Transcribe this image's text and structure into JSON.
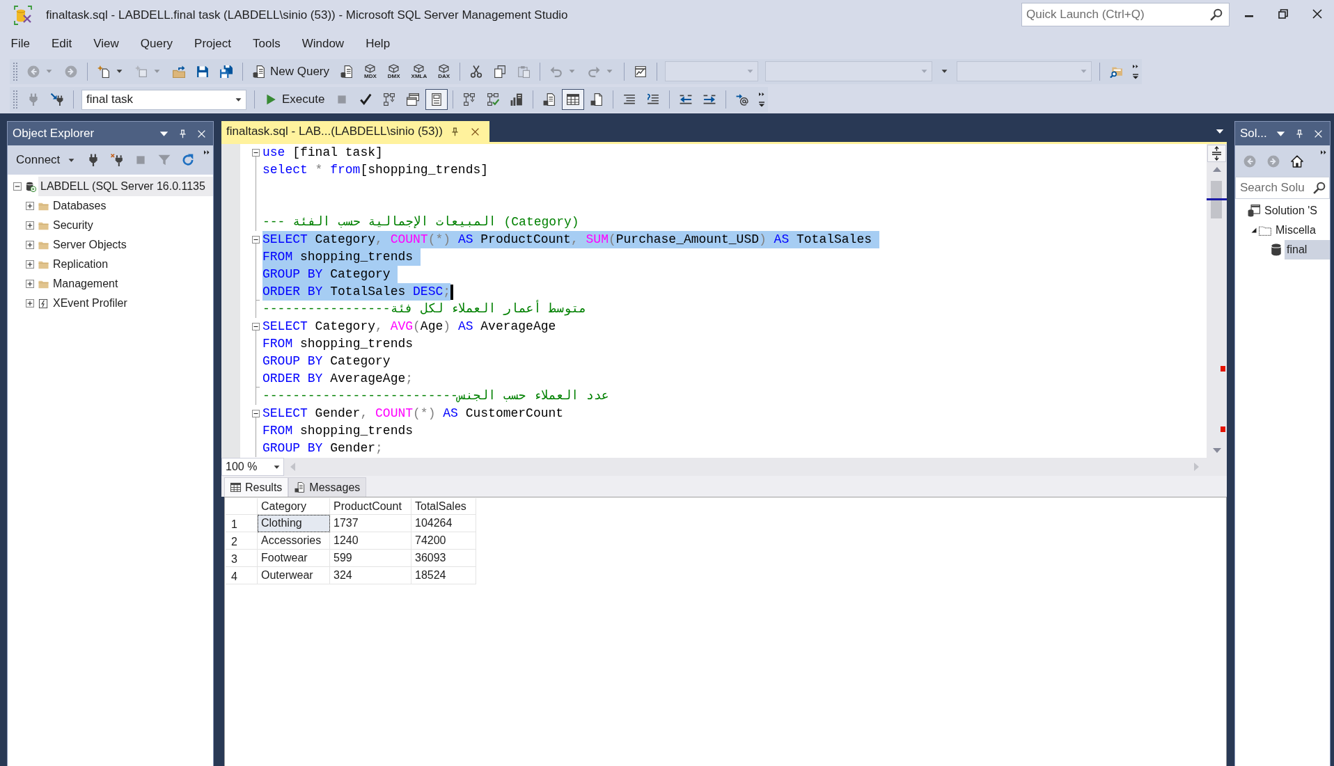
{
  "window": {
    "title": "finaltask.sql - LABDELL.final task (LABDELL\\sinio (53)) - Microsoft SQL Server Management Studio",
    "quick_launch": {
      "placeholder": "Quick Launch (Ctrl+Q)"
    }
  },
  "menu": [
    "File",
    "Edit",
    "View",
    "Query",
    "Project",
    "Tools",
    "Window",
    "Help"
  ],
  "toolbar_1": [
    {
      "kind": "icon",
      "disabled": true,
      "dropdown": true
    },
    {
      "kind": "icon",
      "disabled": true
    },
    {
      "kind": "separator"
    },
    {
      "kind": "icon",
      "disabled": false,
      "dropdown": true
    },
    {
      "kind": "icon",
      "disabled": true,
      "dropdown": true
    },
    {
      "kind": "icon",
      "disabled": false
    },
    {
      "kind": "icon",
      "disabled": false
    },
    {
      "kind": "icon",
      "disabled": false
    },
    {
      "kind": "separator"
    },
    {
      "kind": "textbutton",
      "label": "New Query",
      "disabled": false
    },
    {
      "kind": "icon",
      "disabled": false
    },
    {
      "kind": "tagged",
      "label": "MDX",
      "disabled": false
    },
    {
      "kind": "tagged",
      "label": "DMX",
      "disabled": false
    },
    {
      "kind": "tagged",
      "label": "XMLA",
      "disabled": false
    },
    {
      "kind": "tagged",
      "label": "DAX",
      "disabled": false
    },
    {
      "kind": "separator"
    },
    {
      "kind": "icon",
      "disabled": false
    },
    {
      "kind": "icon",
      "disabled": false
    },
    {
      "kind": "icon",
      "disabled": true
    },
    {
      "kind": "separator"
    },
    {
      "kind": "icon",
      "disabled": true,
      "dropdown": true
    },
    {
      "kind": "icon",
      "disabled": true,
      "dropdown": true
    },
    {
      "kind": "separator"
    },
    {
      "kind": "icon",
      "disabled": false
    },
    {
      "kind": "separator"
    },
    {
      "kind": "combo",
      "disabled": true
    },
    {
      "kind": "combo",
      "disabled": true
    },
    {
      "kind": "dropdown",
      "disabled": false
    },
    {
      "kind": "combo",
      "disabled": true
    },
    {
      "kind": "separator"
    },
    {
      "kind": "icon",
      "disabled": false
    }
  ],
  "toolbar_2": [
    {
      "kind": "icon",
      "disabled": true,
      "pressed": false
    },
    {
      "kind": "icon",
      "disabled": false,
      "pressed": false
    },
    {
      "kind": "separator"
    },
    {
      "kind": "combo",
      "value": "final task",
      "disabled": false
    },
    {
      "kind": "separator"
    },
    {
      "kind": "textbutton",
      "label": "Execute",
      "disabled": false,
      "pressed": false
    },
    {
      "kind": "icon",
      "disabled": true,
      "pressed": false
    },
    {
      "kind": "icon",
      "disabled": false,
      "pressed": false
    },
    {
      "kind": "icon",
      "disabled": false,
      "pressed": false
    },
    {
      "kind": "icon",
      "disabled": false,
      "pressed": false
    },
    {
      "kind": "icon",
      "disabled": false,
      "pressed": true
    },
    {
      "kind": "separator"
    },
    {
      "kind": "icon",
      "disabled": false,
      "pressed": false
    },
    {
      "kind": "icon",
      "disabled": false,
      "pressed": false
    },
    {
      "kind": "icon",
      "disabled": false,
      "pressed": false
    },
    {
      "kind": "separator"
    },
    {
      "kind": "icon",
      "disabled": false,
      "pressed": false
    },
    {
      "kind": "icon",
      "disabled": false,
      "pressed": true
    },
    {
      "kind": "icon",
      "disabled": false,
      "pressed": false
    },
    {
      "kind": "separator"
    },
    {
      "kind": "icon",
      "disabled": false,
      "pressed": false
    },
    {
      "kind": "icon",
      "disabled": false,
      "pressed": false
    },
    {
      "kind": "separator"
    },
    {
      "kind": "icon",
      "disabled": false,
      "pressed": false
    },
    {
      "kind": "icon",
      "disabled": false,
      "pressed": false
    },
    {
      "kind": "separator"
    },
    {
      "kind": "icon",
      "disabled": false,
      "pressed": false
    }
  ],
  "object_explorer": {
    "title": "Object Explorer",
    "toolbar": [
      {
        "kind": "textbutton",
        "label": "Connect",
        "disabled": false,
        "dropdown": true
      },
      {
        "kind": "icon",
        "disabled": false
      },
      {
        "kind": "icon",
        "disabled": false
      },
      {
        "kind": "icon",
        "disabled": true
      },
      {
        "kind": "icon",
        "disabled": true
      },
      {
        "kind": "icon",
        "disabled": false
      }
    ],
    "tree": [
      {
        "label": "LABDELL (SQL Server 16.0.1135",
        "kind": "server",
        "expanded": true,
        "selected": true,
        "children": [
          {
            "label": "Databases",
            "kind": "folder",
            "expanded": false,
            "selected": false
          },
          {
            "label": "Security",
            "kind": "folder",
            "expanded": false,
            "selected": false
          },
          {
            "label": "Server Objects",
            "kind": "folder",
            "expanded": false,
            "selected": false
          },
          {
            "label": "Replication",
            "kind": "folder",
            "expanded": false,
            "selected": false
          },
          {
            "label": "Management",
            "kind": "folder",
            "expanded": false,
            "selected": false
          },
          {
            "label": "XEvent Profiler",
            "kind": "profiler",
            "expanded": false,
            "selected": false
          }
        ]
      }
    ]
  },
  "editor": {
    "tab": {
      "title": "finaltask.sql - LAB...(LABDELL\\sinio (53))",
      "selected": true
    },
    "lines": [
      {
        "kind": "fold",
        "selected": false,
        "cursor": false,
        "tokens": [
          {
            "kind": "keyword",
            "text": "use"
          },
          {
            "kind": "plain",
            "text": " [final task]"
          }
        ]
      },
      {
        "kind": "body",
        "selected": false,
        "cursor": false,
        "tokens": [
          {
            "kind": "keyword",
            "text": "select"
          },
          {
            "kind": "operator",
            "text": " * "
          },
          {
            "kind": "keyword",
            "text": "from"
          },
          {
            "kind": "plain",
            "text": "[shopping_trends]"
          }
        ]
      },
      {
        "kind": "body",
        "selected": false,
        "cursor": false
      },
      {
        "kind": "body",
        "selected": false,
        "cursor": false
      },
      {
        "kind": "body",
        "selected": false,
        "cursor": false,
        "tokens": [
          {
            "kind": "comment",
            "text": "--- المبيعات الإجمالية حسب الفئة (Category)"
          }
        ]
      },
      {
        "kind": "fold",
        "selected": true,
        "cursor": false,
        "tokens": [
          {
            "kind": "keyword",
            "text": "SELECT"
          },
          {
            "kind": "plain",
            "text": " Category"
          },
          {
            "kind": "operator",
            "text": ", "
          },
          {
            "kind": "function",
            "text": "COUNT"
          },
          {
            "kind": "operator",
            "text": "(*) "
          },
          {
            "kind": "keyword",
            "text": "AS"
          },
          {
            "kind": "plain",
            "text": " ProductCount"
          },
          {
            "kind": "operator",
            "text": ", "
          },
          {
            "kind": "function",
            "text": "SUM"
          },
          {
            "kind": "operator",
            "text": "("
          },
          {
            "kind": "plain",
            "text": "Purchase_Amount_USD"
          },
          {
            "kind": "operator",
            "text": ") "
          },
          {
            "kind": "keyword",
            "text": "AS"
          },
          {
            "kind": "plain",
            "text": " TotalSales"
          }
        ]
      },
      {
        "kind": "body",
        "selected": true,
        "cursor": false,
        "tokens": [
          {
            "kind": "keyword",
            "text": "FROM"
          },
          {
            "kind": "plain",
            "text": " shopping_trends"
          }
        ]
      },
      {
        "kind": "body",
        "selected": true,
        "cursor": false,
        "tokens": [
          {
            "kind": "keyword",
            "text": "GROUP BY"
          },
          {
            "kind": "plain",
            "text": " Category"
          }
        ]
      },
      {
        "kind": "end",
        "selected": true,
        "cursor": true,
        "tokens": [
          {
            "kind": "keyword",
            "text": "ORDER BY"
          },
          {
            "kind": "plain",
            "text": " TotalSales "
          },
          {
            "kind": "keyword",
            "text": "DESC"
          },
          {
            "kind": "operator",
            "text": ";"
          }
        ]
      },
      {
        "kind": "body",
        "selected": false,
        "cursor": false,
        "tokens": [
          {
            "kind": "comment",
            "text": "-----------------متوسط أعمار العملاء لكل فئة"
          }
        ]
      },
      {
        "kind": "fold",
        "selected": false,
        "cursor": false,
        "tokens": [
          {
            "kind": "keyword",
            "text": "SELECT"
          },
          {
            "kind": "plain",
            "text": " Category"
          },
          {
            "kind": "operator",
            "text": ", "
          },
          {
            "kind": "function",
            "text": "AVG"
          },
          {
            "kind": "operator",
            "text": "("
          },
          {
            "kind": "plain",
            "text": "Age"
          },
          {
            "kind": "operator",
            "text": ") "
          },
          {
            "kind": "keyword",
            "text": "AS"
          },
          {
            "kind": "plain",
            "text": " AverageAge"
          }
        ]
      },
      {
        "kind": "body",
        "selected": false,
        "cursor": false,
        "tokens": [
          {
            "kind": "keyword",
            "text": "FROM"
          },
          {
            "kind": "plain",
            "text": " shopping_trends"
          }
        ]
      },
      {
        "kind": "body",
        "selected": false,
        "cursor": false,
        "tokens": [
          {
            "kind": "keyword",
            "text": "GROUP BY"
          },
          {
            "kind": "plain",
            "text": " Category"
          }
        ]
      },
      {
        "kind": "end",
        "selected": false,
        "cursor": false,
        "tokens": [
          {
            "kind": "keyword",
            "text": "ORDER BY"
          },
          {
            "kind": "plain",
            "text": " AverageAge"
          },
          {
            "kind": "operator",
            "text": ";"
          }
        ]
      },
      {
        "kind": "body",
        "selected": false,
        "cursor": false,
        "tokens": [
          {
            "kind": "comment",
            "text": "--------------------------عدد العملاء حسب الجنس"
          }
        ]
      },
      {
        "kind": "fold",
        "selected": false,
        "cursor": false,
        "tokens": [
          {
            "kind": "keyword",
            "text": "SELECT"
          },
          {
            "kind": "plain",
            "text": " Gender"
          },
          {
            "kind": "operator",
            "text": ", "
          },
          {
            "kind": "function",
            "text": "COUNT"
          },
          {
            "kind": "operator",
            "text": "(*) "
          },
          {
            "kind": "keyword",
            "text": "AS"
          },
          {
            "kind": "plain",
            "text": " CustomerCount"
          }
        ]
      },
      {
        "kind": "body",
        "selected": false,
        "cursor": false,
        "tokens": [
          {
            "kind": "keyword",
            "text": "FROM"
          },
          {
            "kind": "plain",
            "text": " shopping_trends"
          }
        ]
      },
      {
        "kind": "body",
        "selected": false,
        "cursor": false,
        "tokens": [
          {
            "kind": "keyword",
            "text": "GROUP BY"
          },
          {
            "kind": "plain",
            "text": " Gender"
          },
          {
            "kind": "operator",
            "text": ";"
          }
        ]
      }
    ],
    "zoom": "100 %"
  },
  "results": {
    "tabs": [
      {
        "label": "Results",
        "selected": true
      },
      {
        "label": "Messages",
        "selected": false
      }
    ],
    "columns": [
      "Category",
      "ProductCount",
      "TotalSales"
    ],
    "rows": [
      {
        "number": "1",
        "cells": [
          {
            "text": "Clothing",
            "selected": true
          },
          {
            "text": "1737",
            "selected": false
          },
          {
            "text": "104264",
            "selected": false
          }
        ]
      },
      {
        "number": "2",
        "cells": [
          {
            "text": "Accessories",
            "selected": false
          },
          {
            "text": "1240",
            "selected": false
          },
          {
            "text": "74200",
            "selected": false
          }
        ]
      },
      {
        "number": "3",
        "cells": [
          {
            "text": "Footwear",
            "selected": false
          },
          {
            "text": "599",
            "selected": false
          },
          {
            "text": "36093",
            "selected": false
          }
        ]
      },
      {
        "number": "4",
        "cells": [
          {
            "text": "Outerwear",
            "selected": false
          },
          {
            "text": "324",
            "selected": false
          },
          {
            "text": "18524",
            "selected": false
          }
        ]
      }
    ]
  },
  "solution_explorer": {
    "title": "Sol...",
    "toolbar": [
      {
        "kind": "icon",
        "disabled": true
      },
      {
        "kind": "icon",
        "disabled": true
      },
      {
        "kind": "icon",
        "disabled": false
      }
    ],
    "search": {
      "placeholder": "Search Solu"
    },
    "tree": [
      {
        "label": "Solution 'S",
        "kind": "solution",
        "selected": false,
        "children": [
          {
            "label": "Miscella",
            "kind": "folder",
            "expanded": true,
            "selected": false,
            "children": [
              {
                "label": "final",
                "kind": "file",
                "selected": true
              }
            ]
          }
        ]
      }
    ]
  }
}
